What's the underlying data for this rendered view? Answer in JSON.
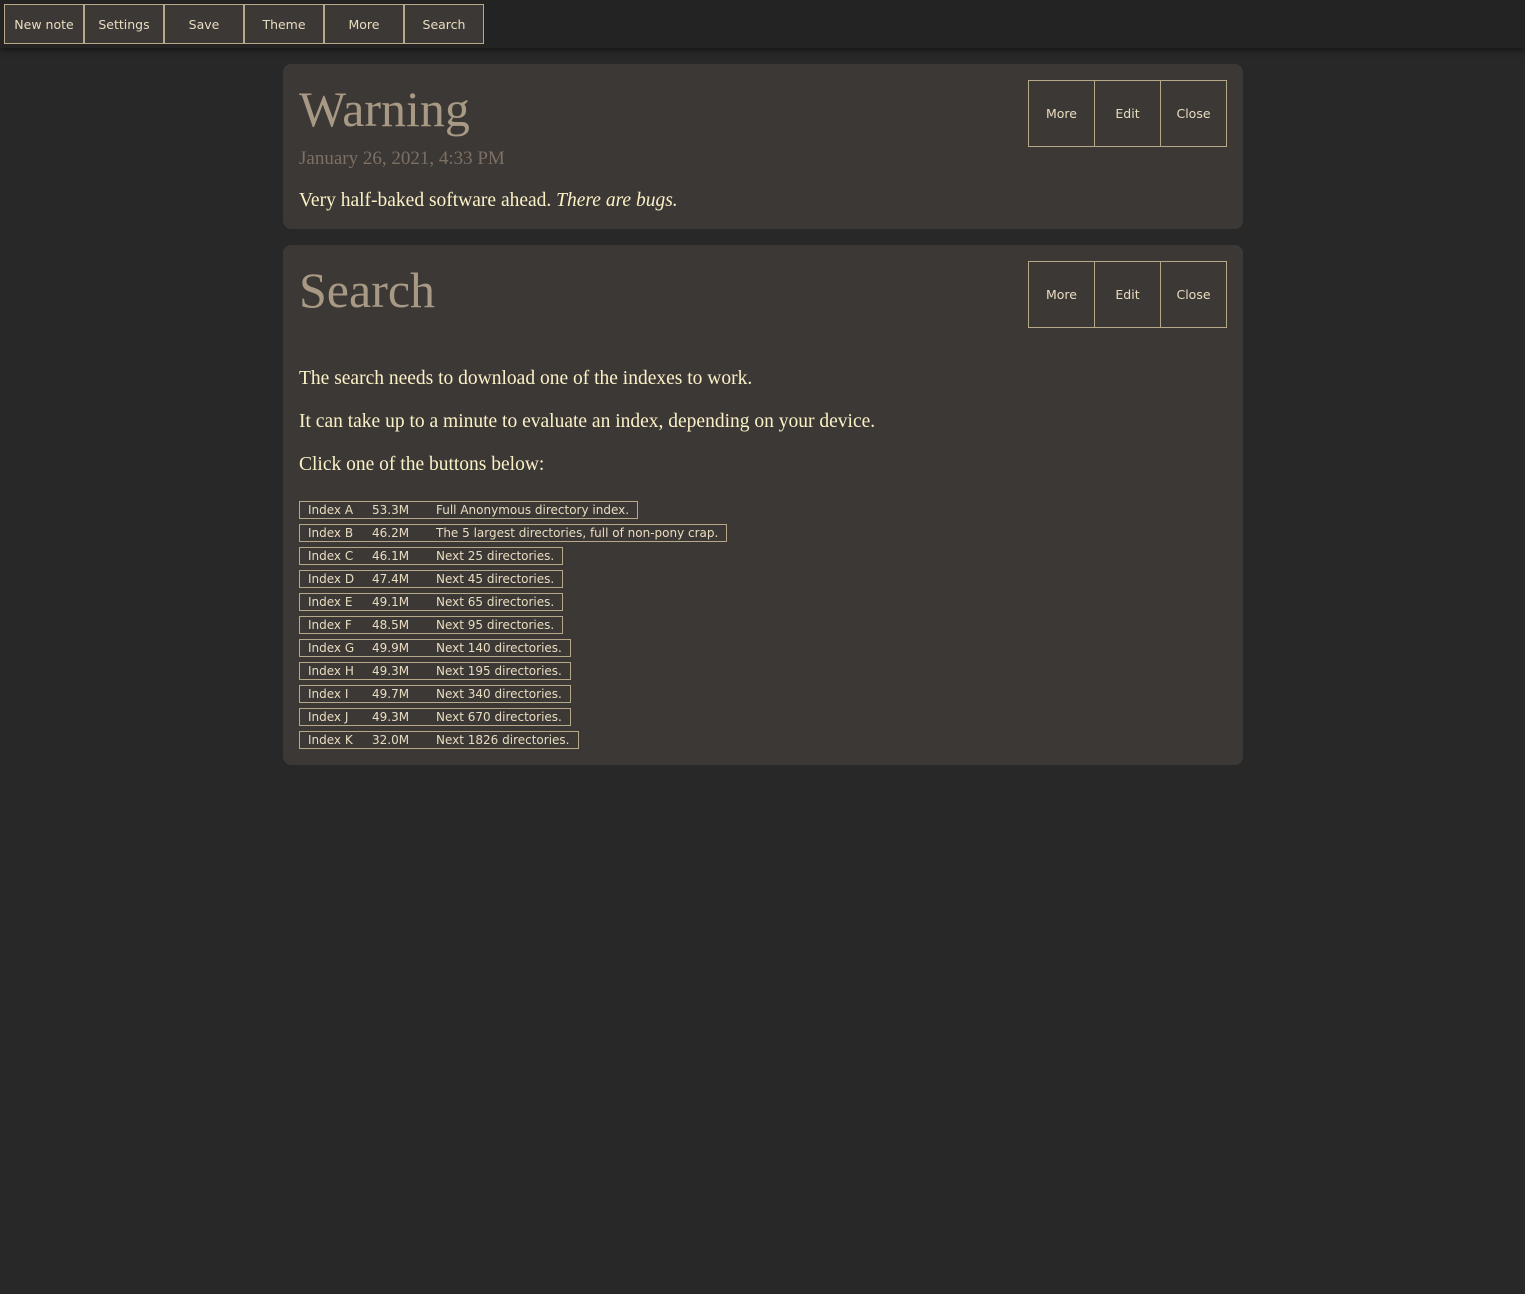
{
  "toolbar": {
    "buttons": [
      "New note",
      "Settings",
      "Save",
      "Theme",
      "More",
      "Search"
    ]
  },
  "card_buttons": {
    "more": "More",
    "edit": "Edit",
    "close": "Close"
  },
  "warning": {
    "title": "Warning",
    "date": "January 26, 2021, 4:33 PM",
    "text": "Very half-baked software ahead.",
    "emphasis": "There are bugs."
  },
  "search": {
    "title": "Search",
    "paragraphs": [
      "The search needs to download one of the indexes to work.",
      "It can take up to a minute to evaluate an index, depending on your device.",
      "Click one of the buttons below:"
    ],
    "indexes": [
      {
        "name": "Index A",
        "size": "53.3M",
        "desc": "Full Anonymous directory index."
      },
      {
        "name": "Index B",
        "size": "46.2M",
        "desc": "The 5 largest directories, full of non-pony crap."
      },
      {
        "name": "Index C",
        "size": "46.1M",
        "desc": "Next 25 directories."
      },
      {
        "name": "Index D",
        "size": "47.4M",
        "desc": "Next 45 directories."
      },
      {
        "name": "Index E",
        "size": "49.1M",
        "desc": "Next 65 directories."
      },
      {
        "name": "Index F",
        "size": "48.5M",
        "desc": "Next 95 directories."
      },
      {
        "name": "Index G",
        "size": "49.9M",
        "desc": "Next 140 directories."
      },
      {
        "name": "Index H",
        "size": "49.3M",
        "desc": "Next 195 directories."
      },
      {
        "name": "Index I",
        "size": "49.7M",
        "desc": "Next 340 directories."
      },
      {
        "name": "Index J",
        "size": "49.3M",
        "desc": "Next 670 directories."
      },
      {
        "name": "Index K",
        "size": "32.0M",
        "desc": "Next 1826 directories."
      }
    ]
  }
}
